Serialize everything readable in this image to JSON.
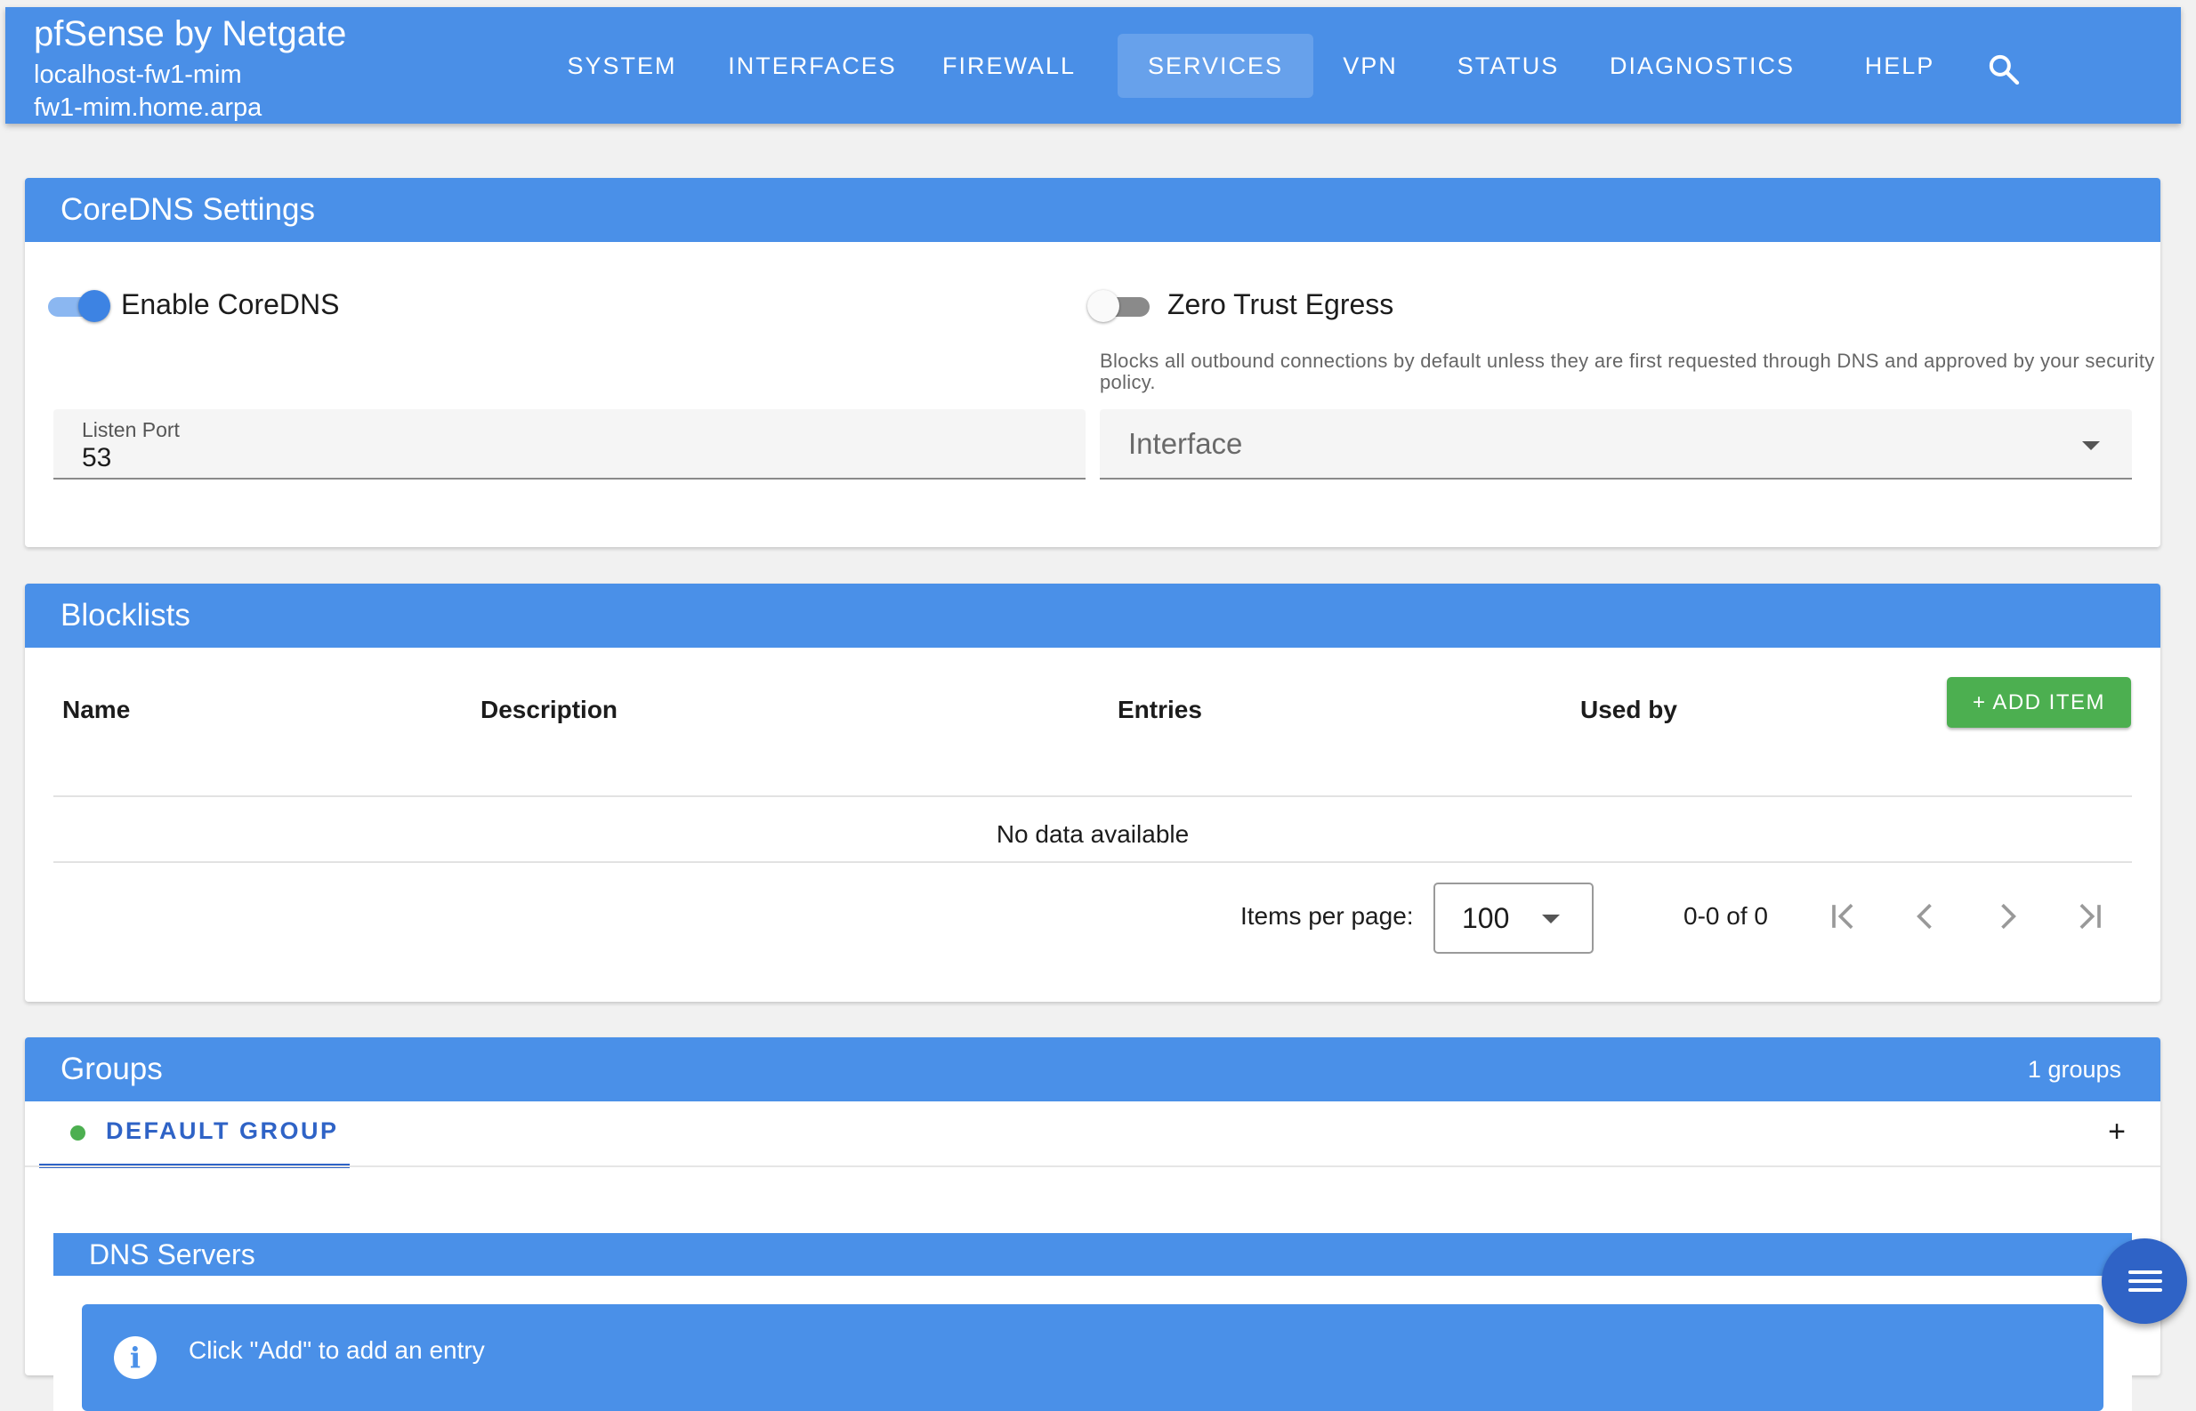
{
  "brand": {
    "title": "pfSense by Netgate",
    "hostname": "localhost-fw1-mim",
    "domain": "fw1-mim.home.arpa"
  },
  "nav": {
    "items": [
      "SYSTEM",
      "INTERFACES",
      "FIREWALL",
      "SERVICES",
      "VPN",
      "STATUS",
      "DIAGNOSTICS",
      "HELP"
    ],
    "active": "SERVICES",
    "search_icon": "search-icon"
  },
  "settings": {
    "title": "CoreDNS Settings",
    "enable_label": "Enable CoreDNS",
    "enable_on": true,
    "zero_trust_label": "Zero Trust Egress",
    "zero_trust_on": false,
    "zero_trust_help": "Blocks all outbound connections by default unless they are first requested through DNS and approved by your security policy.",
    "listen_port_label": "Listen Port",
    "listen_port_value": "53",
    "interface_placeholder": "Interface"
  },
  "blocklists": {
    "title": "Blocklists",
    "add_label": "+ ADD ITEM",
    "columns": [
      "Name",
      "Description",
      "Entries",
      "Used by"
    ],
    "empty_text": "No data available",
    "items_per_page_label": "Items per page:",
    "items_per_page_value": "100",
    "range_text": "0-0 of 0"
  },
  "groups": {
    "title": "Groups",
    "count_text": "1 groups",
    "tab_label": "DEFAULT GROUP",
    "add_tab": "+",
    "dns_servers_title": "DNS Servers",
    "info_text": "Click \"Add\" to add an entry"
  },
  "colors": {
    "primary": "#4a90e8",
    "active_tab": "#2f63c6",
    "success": "#4caf50"
  }
}
